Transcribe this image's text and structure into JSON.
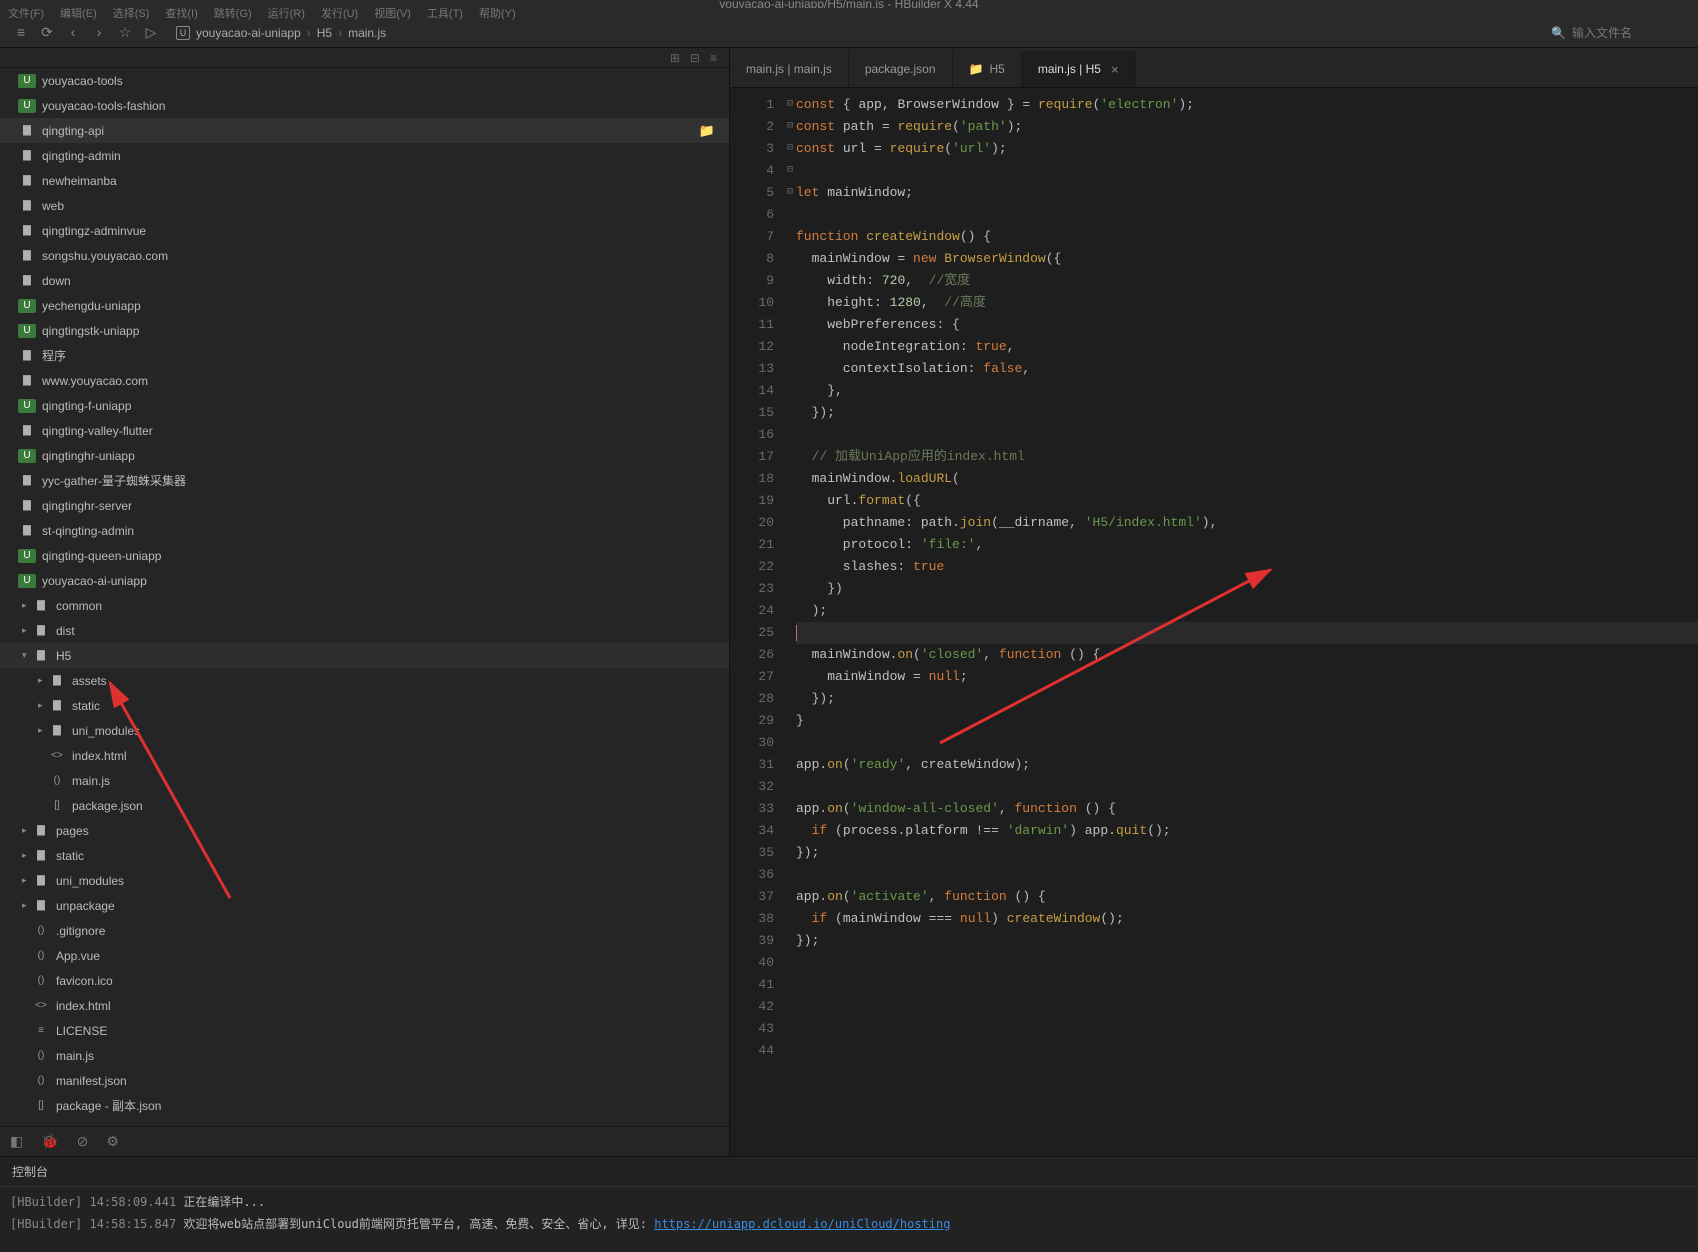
{
  "title_bar": "youyacao-ai-uniapp/H5/main.js - HBuilder X 4.44",
  "menu": [
    "文件(F)",
    "编辑(E)",
    "选择(S)",
    "查找(I)",
    "跳转(G)",
    "运行(R)",
    "发行(U)",
    "视图(V)",
    "工具(T)",
    "帮助(Y)"
  ],
  "toolbar": {
    "icons": [
      "≡",
      "⟳",
      "‹",
      "›",
      "☆",
      "▷"
    ],
    "breadcrumb": [
      "youyacao-ai-uniapp",
      "H5",
      "main.js"
    ],
    "search_icon": "🔍",
    "search_placeholder": "输入文件名"
  },
  "tree_toolbar_icons": [
    "⊞",
    "⊟",
    "≡"
  ],
  "tree": [
    {
      "icon": "u",
      "label": "youyacao-tools",
      "depth": 0
    },
    {
      "icon": "u",
      "label": "youyacao-tools-fashion",
      "depth": 0
    },
    {
      "icon": "folder",
      "label": "qingting-api",
      "depth": 0,
      "selected": true,
      "right": "📁"
    },
    {
      "icon": "folder",
      "label": "qingting-admin",
      "depth": 0
    },
    {
      "icon": "folder",
      "label": "newheimanba",
      "depth": 0
    },
    {
      "icon": "folder",
      "label": "web",
      "depth": 0
    },
    {
      "icon": "folder",
      "label": "qingtingz-adminvue",
      "depth": 0
    },
    {
      "icon": "folder",
      "label": "songshu.youyacao.com",
      "depth": 0
    },
    {
      "icon": "folder",
      "label": "down",
      "depth": 0
    },
    {
      "icon": "u",
      "label": "yechengdu-uniapp",
      "depth": 0
    },
    {
      "icon": "u",
      "label": "qingtingstk-uniapp",
      "depth": 0
    },
    {
      "icon": "folder",
      "label": "程序",
      "depth": 0
    },
    {
      "icon": "folder",
      "label": "www.youyacao.com",
      "depth": 0
    },
    {
      "icon": "u",
      "label": "qingting-f-uniapp",
      "depth": 0
    },
    {
      "icon": "folder",
      "label": "qingting-valley-flutter",
      "depth": 0
    },
    {
      "icon": "u",
      "label": "qingtinghr-uniapp",
      "depth": 0
    },
    {
      "icon": "folder",
      "label": "yyc-gather-量子蜘蛛采集器",
      "depth": 0
    },
    {
      "icon": "folder",
      "label": "qingtinghr-server",
      "depth": 0
    },
    {
      "icon": "folder",
      "label": "st-qingting-admin",
      "depth": 0
    },
    {
      "icon": "u",
      "label": "qingting-queen-uniapp",
      "depth": 0
    },
    {
      "icon": "u",
      "label": "youyacao-ai-uniapp",
      "depth": 0,
      "expanded": true
    },
    {
      "icon": "folder",
      "label": "common",
      "depth": 1,
      "arrow": ">"
    },
    {
      "icon": "folder",
      "label": "dist",
      "depth": 1,
      "arrow": ">"
    },
    {
      "icon": "folder",
      "label": "H5",
      "depth": 1,
      "arrow": "v",
      "highlight": true
    },
    {
      "icon": "folder",
      "label": "assets",
      "depth": 2,
      "arrow": ">"
    },
    {
      "icon": "folder",
      "label": "static",
      "depth": 2,
      "arrow": ">"
    },
    {
      "icon": "folder",
      "label": "uni_modules",
      "depth": 2,
      "arrow": ">"
    },
    {
      "icon": "file-code",
      "label": "index.html",
      "depth": 2,
      "fileicon": "<>"
    },
    {
      "icon": "file-code",
      "label": "main.js",
      "depth": 2,
      "fileicon": "()"
    },
    {
      "icon": "file-json",
      "label": "package.json",
      "depth": 2,
      "fileicon": "[]"
    },
    {
      "icon": "folder",
      "label": "pages",
      "depth": 1,
      "arrow": ">"
    },
    {
      "icon": "folder",
      "label": "static",
      "depth": 1,
      "arrow": ">"
    },
    {
      "icon": "folder",
      "label": "uni_modules",
      "depth": 1,
      "arrow": ">"
    },
    {
      "icon": "folder",
      "label": "unpackage",
      "depth": 1,
      "arrow": ">"
    },
    {
      "icon": "file-code",
      "label": ".gitignore",
      "depth": 1,
      "fileicon": "()"
    },
    {
      "icon": "file-code",
      "label": "App.vue",
      "depth": 1,
      "fileicon": "()"
    },
    {
      "icon": "file-code",
      "label": "favicon.ico",
      "depth": 1,
      "fileicon": "()"
    },
    {
      "icon": "file-code",
      "label": "index.html",
      "depth": 1,
      "fileicon": "<>"
    },
    {
      "icon": "file-code",
      "label": "LICENSE",
      "depth": 1,
      "fileicon": "≡"
    },
    {
      "icon": "file-code",
      "label": "main.js",
      "depth": 1,
      "fileicon": "()"
    },
    {
      "icon": "file-code",
      "label": "manifest.json",
      "depth": 1,
      "fileicon": "()"
    },
    {
      "icon": "file-json",
      "label": "package - 副本.json",
      "depth": 1,
      "fileicon": "[]"
    }
  ],
  "sidebar_bottom_icons": [
    "◧",
    "🐞",
    "⊘",
    "⚙"
  ],
  "tabs": [
    {
      "label": "main.js | main.js",
      "active": false
    },
    {
      "label": "package.json",
      "active": false
    },
    {
      "label": "H5",
      "active": false,
      "icon": "📁"
    },
    {
      "label": "main.js | H5",
      "active": true,
      "close": true
    }
  ],
  "code_lines": [
    {
      "n": 1,
      "html": "<span class='kw'>const</span> <span class='punc'>{</span> app<span class='punc'>,</span> BrowserWindow <span class='punc'>}</span> <span class='punc'>=</span> <span class='fn'>require</span><span class='punc'>(</span><span class='str'>'electron'</span><span class='punc'>);</span>"
    },
    {
      "n": 2,
      "html": "<span class='kw'>const</span> path <span class='punc'>=</span> <span class='fn'>require</span><span class='punc'>(</span><span class='str'>'path'</span><span class='punc'>);</span>"
    },
    {
      "n": 3,
      "html": "<span class='kw'>const</span> url <span class='punc'>=</span> <span class='fn'>require</span><span class='punc'>(</span><span class='str'>'url'</span><span class='punc'>);</span>"
    },
    {
      "n": 4,
      "html": ""
    },
    {
      "n": 5,
      "html": "<span class='kw'>let</span> mainWindow<span class='punc'>;</span>"
    },
    {
      "n": 6,
      "html": ""
    },
    {
      "n": 7,
      "fold": "⊟",
      "html": "<span class='kw'>function</span> <span class='fn'>createWindow</span><span class='punc'>() {</span>"
    },
    {
      "n": 8,
      "html": "  mainWindow <span class='punc'>=</span> <span class='kw'>new</span> <span class='fn'>BrowserWindow</span><span class='punc'>({</span>"
    },
    {
      "n": 9,
      "html": "    width<span class='punc'>:</span> <span class='num'>720</span><span class='punc'>,</span>  <span class='cmt'>//宽度</span>"
    },
    {
      "n": 10,
      "html": "    height<span class='punc'>:</span> <span class='num'>1280</span><span class='punc'>,</span>  <span class='cmt'>//高度</span>"
    },
    {
      "n": 11,
      "fold": "⊟",
      "html": "    webPreferences<span class='punc'>: {</span>"
    },
    {
      "n": 12,
      "html": "      nodeIntegration<span class='punc'>:</span> <span class='bool'>true</span><span class='punc'>,</span>"
    },
    {
      "n": 13,
      "html": "      contextIsolation<span class='punc'>:</span> <span class='bool'>false</span><span class='punc'>,</span>"
    },
    {
      "n": 14,
      "html": "    <span class='punc'>},</span>"
    },
    {
      "n": 15,
      "html": "  <span class='punc'>});</span>"
    },
    {
      "n": 16,
      "html": ""
    },
    {
      "n": 17,
      "html": "  <span class='cmt'>// 加载UniApp应用的index.html</span>"
    },
    {
      "n": 18,
      "html": "  mainWindow<span class='punc'>.</span><span class='fn'>loadURL</span><span class='punc'>(</span>"
    },
    {
      "n": 19,
      "fold": "⊟",
      "html": "    url<span class='punc'>.</span><span class='fn'>format</span><span class='punc'>({</span>"
    },
    {
      "n": 20,
      "html": "      pathname<span class='punc'>:</span> path<span class='punc'>.</span><span class='fn'>join</span><span class='punc'>(</span>__dirname<span class='punc'>,</span> <span class='str'>'H5/index.html'</span><span class='punc'>),</span>"
    },
    {
      "n": 21,
      "html": "      protocol<span class='punc'>:</span> <span class='str'>'file:'</span><span class='punc'>,</span>"
    },
    {
      "n": 22,
      "html": "      slashes<span class='punc'>:</span> <span class='bool'>true</span>"
    },
    {
      "n": 23,
      "html": "    <span class='punc'>})</span>"
    },
    {
      "n": 24,
      "html": "  <span class='punc'>);</span>"
    },
    {
      "n": 25,
      "highlight": true,
      "html": "<span class='cursor'></span>"
    },
    {
      "n": 26,
      "html": "  mainWindow<span class='punc'>.</span><span class='fn'>on</span><span class='punc'>(</span><span class='str'>'closed'</span><span class='punc'>,</span> <span class='kw'>function</span> <span class='punc'>() {</span>"
    },
    {
      "n": 27,
      "html": "    mainWindow <span class='punc'>=</span> <span class='bool'>null</span><span class='punc'>;</span>"
    },
    {
      "n": 28,
      "html": "  <span class='punc'>});</span>"
    },
    {
      "n": 29,
      "html": "<span class='punc'>}</span>"
    },
    {
      "n": 30,
      "html": ""
    },
    {
      "n": 31,
      "html": "app<span class='punc'>.</span><span class='fn'>on</span><span class='punc'>(</span><span class='str'>'ready'</span><span class='punc'>,</span> createWindow<span class='punc'>);</span>"
    },
    {
      "n": 32,
      "html": ""
    },
    {
      "n": 33,
      "fold": "⊟",
      "html": "app<span class='punc'>.</span><span class='fn'>on</span><span class='punc'>(</span><span class='str'>'window-all-closed'</span><span class='punc'>,</span> <span class='kw'>function</span> <span class='punc'>() {</span>"
    },
    {
      "n": 34,
      "html": "  <span class='kw'>if</span> <span class='punc'>(</span>process<span class='punc'>.</span>platform <span class='punc'>!==</span> <span class='str'>'darwin'</span><span class='punc'>)</span> app<span class='punc'>.</span><span class='fn'>quit</span><span class='punc'>();</span>"
    },
    {
      "n": 35,
      "html": "<span class='punc'>});</span>"
    },
    {
      "n": 36,
      "html": ""
    },
    {
      "n": 37,
      "fold": "⊟",
      "html": "app<span class='punc'>.</span><span class='fn'>on</span><span class='punc'>(</span><span class='str'>'activate'</span><span class='punc'>,</span> <span class='kw'>function</span> <span class='punc'>() {</span>"
    },
    {
      "n": 38,
      "html": "  <span class='kw'>if</span> <span class='punc'>(</span>mainWindow <span class='punc'>===</span> <span class='bool'>null</span><span class='punc'>)</span> <span class='fn'>createWindow</span><span class='punc'>();</span>"
    },
    {
      "n": 39,
      "html": "<span class='punc'>});</span>"
    },
    {
      "n": 40,
      "html": ""
    },
    {
      "n": 41,
      "html": ""
    },
    {
      "n": 42,
      "html": ""
    },
    {
      "n": 43,
      "html": ""
    },
    {
      "n": 44,
      "html": ""
    }
  ],
  "console": {
    "title": "控制台",
    "lines": [
      {
        "tag": "[HBuilder]",
        "time": "14:58:09.441",
        "text": " 正在编译中...",
        "link": ""
      },
      {
        "tag": "[HBuilder]",
        "time": "14:58:15.847",
        "text": " 欢迎将web站点部署到uniCloud前端网页托管平台, 高速、免费、安全、省心, 详见: ",
        "link": "https://uniapp.dcloud.io/uniCloud/hosting"
      }
    ]
  }
}
